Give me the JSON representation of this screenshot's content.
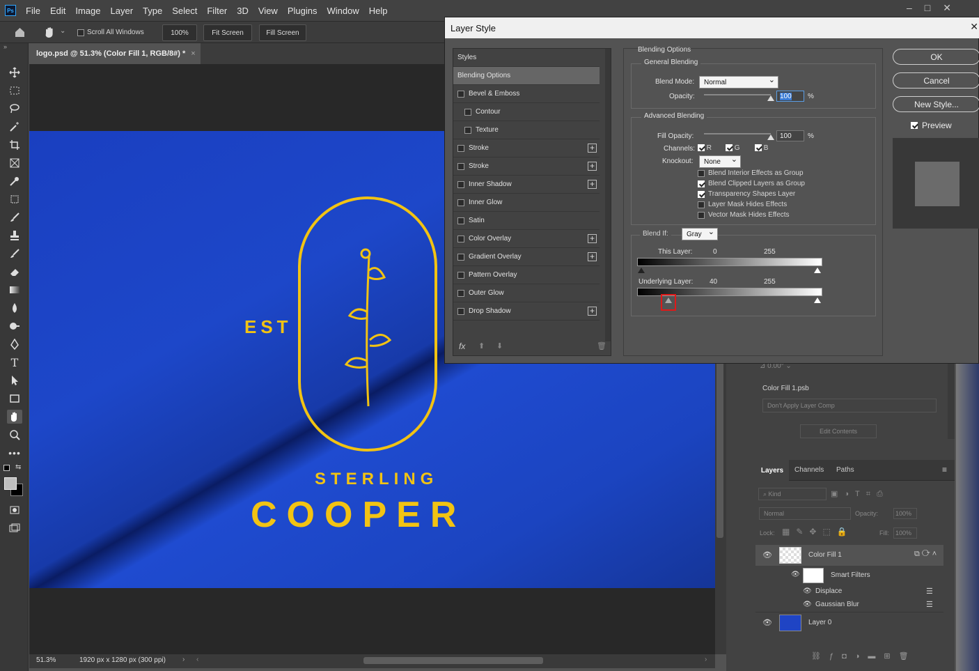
{
  "app": {
    "logo": "Ps",
    "menu": [
      "File",
      "Edit",
      "Image",
      "Layer",
      "Type",
      "Select",
      "Filter",
      "3D",
      "View",
      "Plugins",
      "Window",
      "Help"
    ]
  },
  "options": {
    "scroll_all_windows": "Scroll All Windows",
    "zoom": "100%",
    "fit_screen": "Fit Screen",
    "fill_screen": "Fill Screen"
  },
  "document": {
    "tab_title": "logo.psd @ 51.3% (Color Fill 1, RGB/8#) *",
    "zoom": "51.3%",
    "info": "1920 px x 1280 px (300 ppi)"
  },
  "artwork": {
    "est": "EST",
    "brand_line1": "STERLING",
    "brand_line2": "COOPER"
  },
  "right_panel": {
    "angle": "0.00°",
    "smart_object": "Color Fill 1.psb",
    "layer_comp": "Don't Apply Layer Comp",
    "edit_contents": "Edit Contents",
    "tabs": [
      "Layers",
      "Channels",
      "Paths"
    ],
    "kind": "Kind",
    "blend_mode": "Normal",
    "opacity_label": "Opacity:",
    "opacity": "100%",
    "lock_label": "Lock:",
    "fill_label": "Fill:",
    "fill": "100%",
    "layers": [
      {
        "name": "Color Fill 1"
      },
      {
        "name": "Smart Filters"
      },
      {
        "name": "Displace"
      },
      {
        "name": "Gaussian Blur"
      },
      {
        "name": "Layer 0"
      }
    ]
  },
  "dialog": {
    "title": "Layer Style",
    "styles_header": "Styles",
    "items": [
      {
        "label": "Blending Options",
        "checkbox": false,
        "plus": false,
        "active": true
      },
      {
        "label": "Bevel & Emboss",
        "checkbox": true,
        "plus": false
      },
      {
        "label": "Contour",
        "checkbox": true,
        "plus": false,
        "indent": true
      },
      {
        "label": "Texture",
        "checkbox": true,
        "plus": false,
        "indent": true
      },
      {
        "label": "Stroke",
        "checkbox": true,
        "plus": true
      },
      {
        "label": "Stroke",
        "checkbox": true,
        "plus": true
      },
      {
        "label": "Inner Shadow",
        "checkbox": true,
        "plus": true
      },
      {
        "label": "Inner Glow",
        "checkbox": true,
        "plus": false
      },
      {
        "label": "Satin",
        "checkbox": true,
        "plus": false
      },
      {
        "label": "Color Overlay",
        "checkbox": true,
        "plus": true
      },
      {
        "label": "Gradient Overlay",
        "checkbox": true,
        "plus": true
      },
      {
        "label": "Pattern Overlay",
        "checkbox": true,
        "plus": false
      },
      {
        "label": "Outer Glow",
        "checkbox": true,
        "plus": false
      },
      {
        "label": "Drop Shadow",
        "checkbox": true,
        "plus": true
      }
    ],
    "fx": "fx",
    "blending": {
      "section_title": "Blending Options",
      "general_title": "General Blending",
      "blend_mode_label": "Blend Mode:",
      "blend_mode": "Normal",
      "opacity_label": "Opacity:",
      "opacity": "100",
      "opacity_level": 1.0,
      "percent": "%",
      "advanced_title": "Advanced Blending",
      "fill_opacity_label": "Fill Opacity:",
      "fill_opacity": "100",
      "fill_level": 1.0,
      "channels_label": "Channels:",
      "channel_r": "R",
      "channel_g": "G",
      "channel_b": "B",
      "knockout_label": "Knockout:",
      "knockout": "None",
      "options": [
        {
          "label": "Blend Interior Effects as Group",
          "checked": false
        },
        {
          "label": "Blend Clipped Layers as Group",
          "checked": true
        },
        {
          "label": "Transparency Shapes Layer",
          "checked": true
        },
        {
          "label": "Layer Mask Hides Effects",
          "checked": false
        },
        {
          "label": "Vector Mask Hides Effects",
          "checked": false
        }
      ],
      "blend_if_label": "Blend If:",
      "blend_if": "Gray",
      "this_layer_label": "This Layer:",
      "this_low": "0",
      "this_high": "255",
      "underlying_label": "Underlying Layer:",
      "under_low": "40",
      "under_high": "255"
    },
    "buttons": {
      "ok": "OK",
      "cancel": "Cancel",
      "new_style": "New Style...",
      "preview": "Preview"
    }
  }
}
